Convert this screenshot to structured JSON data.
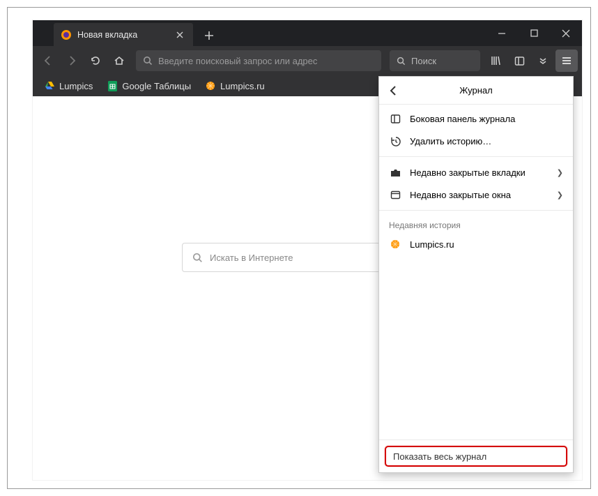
{
  "titlebar": {
    "tab_title": "Новая вкладка",
    "newtab_tooltip": "+"
  },
  "navbar": {
    "url_placeholder": "Введите поисковый запрос или адрес",
    "search_placeholder": "Поиск"
  },
  "bookmarks": [
    {
      "label": "Lumpics",
      "icon": "drive"
    },
    {
      "label": "Google Таблицы",
      "icon": "sheets"
    },
    {
      "label": "Lumpics.ru",
      "icon": "orange"
    }
  ],
  "content": {
    "search_placeholder": "Искать в Интернете"
  },
  "menu": {
    "title": "Журнал",
    "items": {
      "sidebar": "Боковая панель журнала",
      "clear": "Удалить историю…",
      "closed_tabs": "Недавно закрытые вкладки",
      "closed_windows": "Недавно закрытые окна"
    },
    "recent_section": "Недавняя история",
    "recent": [
      {
        "label": "Lumpics.ru",
        "icon": "orange"
      }
    ],
    "show_all": "Показать весь журнал"
  }
}
